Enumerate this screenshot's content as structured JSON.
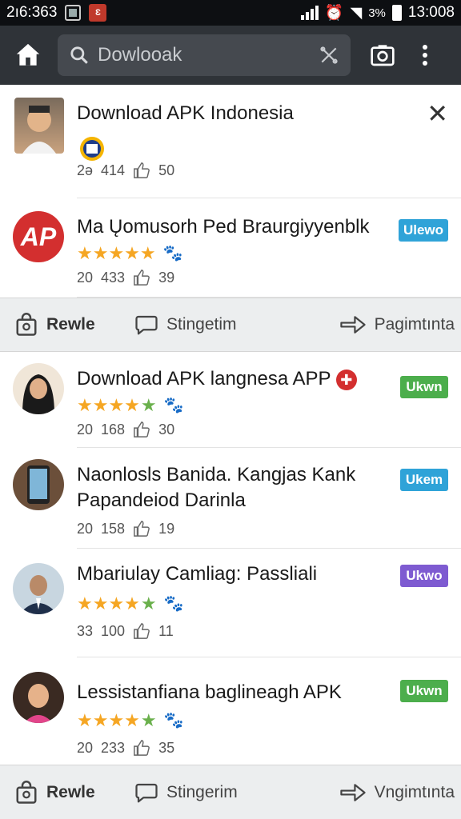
{
  "status_bar": {
    "left_text": "2ı6:363",
    "time": "13:008",
    "batt_text": "3%"
  },
  "search": {
    "placeholder": "Dowlooak"
  },
  "items": [
    {
      "title": "Download APK Indonesia",
      "stats": [
        "2ə",
        "414",
        "50"
      ],
      "trailing": "close"
    },
    {
      "title": "Ma Ųomusorh Ped Braurgiyyenblk",
      "stats": [
        "20",
        "433",
        "39"
      ],
      "badge": "Ulewo",
      "badge_color": "#2fa3d8"
    }
  ],
  "action_bar": {
    "a1": "Rewle",
    "a2": "Stingetim",
    "a3": "Pagimtınta"
  },
  "items2": [
    {
      "title": "Download APK langnesa APP",
      "stats": [
        "20",
        "168",
        "30"
      ],
      "badge": "Ukwn",
      "badge_color": "#4cae4c"
    },
    {
      "title": "Naonlosls Banida. Kangjas Kank Papandeiod Darinla",
      "stats": [
        "20",
        "158",
        "19"
      ],
      "badge": "Ukem",
      "badge_color": "#2fa3d8"
    },
    {
      "title": "Mbariulay Camliag: Passliali",
      "stats": [
        "33",
        "100",
        "11"
      ],
      "badge": "Ukwo",
      "badge_color": "#7e5bd1"
    },
    {
      "title": "Lessistanfiana baglineagh APK",
      "stats": [
        "20",
        "233",
        "35"
      ],
      "badge": "Ukwn",
      "badge_color": "#4cae4c"
    }
  ],
  "bottom_bar": {
    "a1": "Rewle",
    "a2": "Stingerim",
    "a3": "Vngimtınta"
  }
}
